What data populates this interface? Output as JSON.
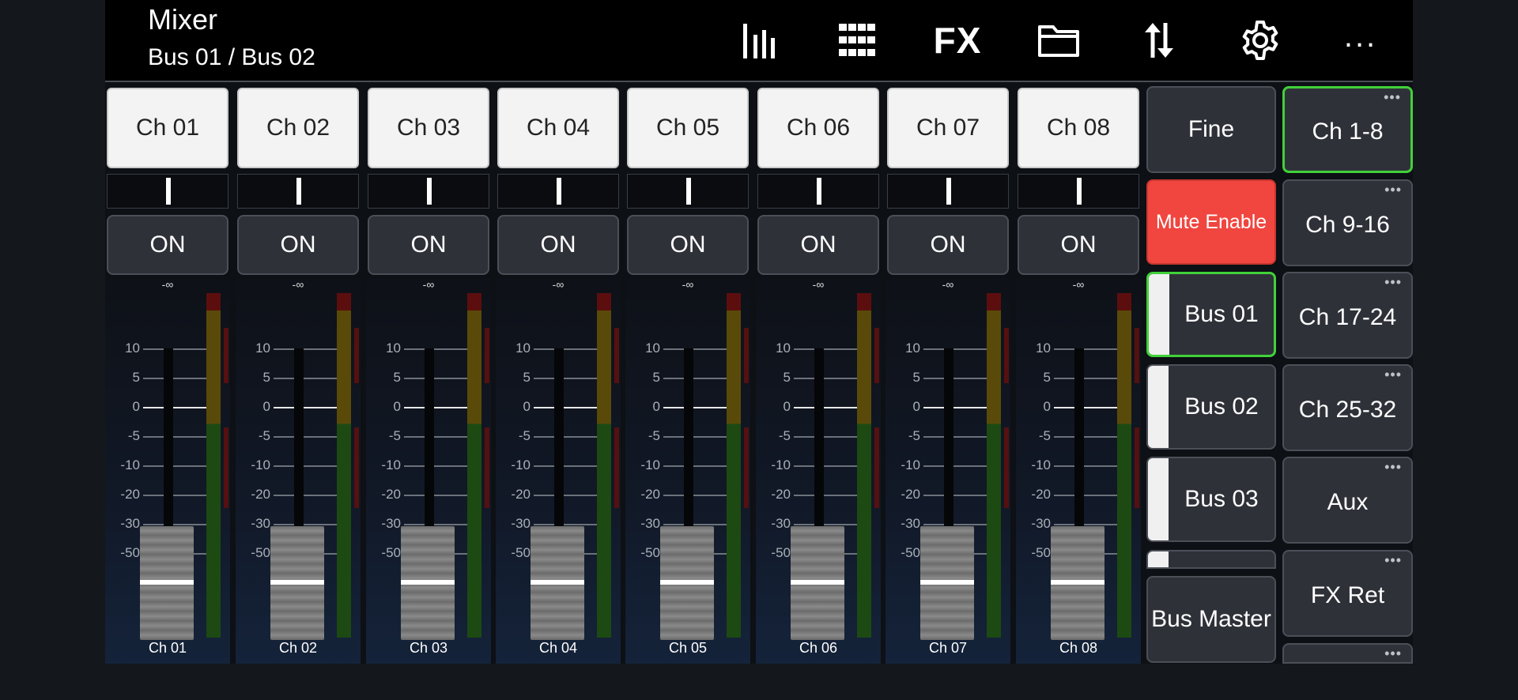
{
  "header": {
    "title": "Mixer",
    "subtitle": "Bus 01 / Bus 02",
    "icons": [
      "meters-icon",
      "grid-icon",
      "fx-icon",
      "folder-icon",
      "routing-arrows-icon",
      "gear-icon",
      "more-icon"
    ],
    "fx_label": "FX",
    "more_label": "..."
  },
  "channels": [
    {
      "label": "Ch 01",
      "on_label": "ON",
      "level": "-∞",
      "name": "Ch 01"
    },
    {
      "label": "Ch 02",
      "on_label": "ON",
      "level": "-∞",
      "name": "Ch 02"
    },
    {
      "label": "Ch 03",
      "on_label": "ON",
      "level": "-∞",
      "name": "Ch 03"
    },
    {
      "label": "Ch 04",
      "on_label": "ON",
      "level": "-∞",
      "name": "Ch 04"
    },
    {
      "label": "Ch 05",
      "on_label": "ON",
      "level": "-∞",
      "name": "Ch 05"
    },
    {
      "label": "Ch 06",
      "on_label": "ON",
      "level": "-∞",
      "name": "Ch 06"
    },
    {
      "label": "Ch 07",
      "on_label": "ON",
      "level": "-∞",
      "name": "Ch 07"
    },
    {
      "label": "Ch 08",
      "on_label": "ON",
      "level": "-∞",
      "name": "Ch 08"
    }
  ],
  "scale_ticks": [
    "10",
    "5",
    "0",
    "-5",
    "-10",
    "-20",
    "-30",
    "-50"
  ],
  "controls": {
    "fine": "Fine",
    "mute_enable": "Mute Enable",
    "buses": [
      "Bus 01",
      "Bus 02",
      "Bus 03"
    ],
    "selected_bus": "Bus 01",
    "bus_master": "Bus Master"
  },
  "banks": {
    "items": [
      "Ch 1-8",
      "Ch 9-16",
      "Ch 17-24",
      "Ch 25-32",
      "Aux",
      "FX Ret"
    ],
    "selected": "Ch 1-8",
    "dots": "•••"
  },
  "colors": {
    "accent_green": "#41d13a",
    "mute_red": "#f0463f",
    "button_dark": "#2f3139",
    "channel_button": "#f3f3f3"
  }
}
